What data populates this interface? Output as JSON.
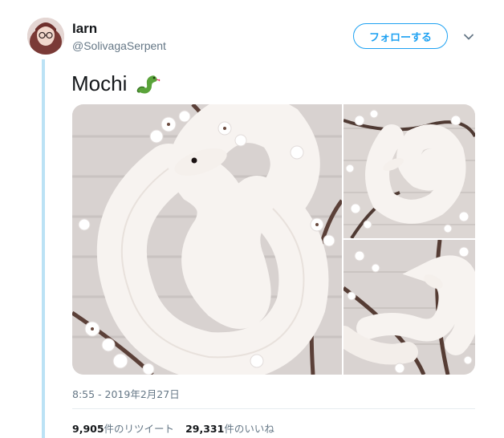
{
  "author": {
    "display_name": "Iarn",
    "handle": "@SolivagaSerpent",
    "avatar": "profile-photo"
  },
  "follow_button": {
    "label": "フォローする"
  },
  "menu": {
    "icon": "chevron-down-icon"
  },
  "tweet": {
    "text": "Mochi",
    "emoji": "snake-emoji",
    "media": [
      {
        "description": "white-snake-coiled-in-blossoms"
      },
      {
        "description": "white-snake-on-branch"
      },
      {
        "description": "white-snake-wrapped-on-branch"
      }
    ],
    "timestamp": "8:55 - 2019年2月27日"
  },
  "stats": {
    "retweets_count": "9,905",
    "retweets_label": "件のリツイート",
    "likes_count": "29,331",
    "likes_label": "件のいいね"
  },
  "colors": {
    "accent": "#1da1f2",
    "thread_line": "#bbe2f5",
    "secondary_text": "#657786",
    "snake_emoji": "#5aa33a"
  }
}
